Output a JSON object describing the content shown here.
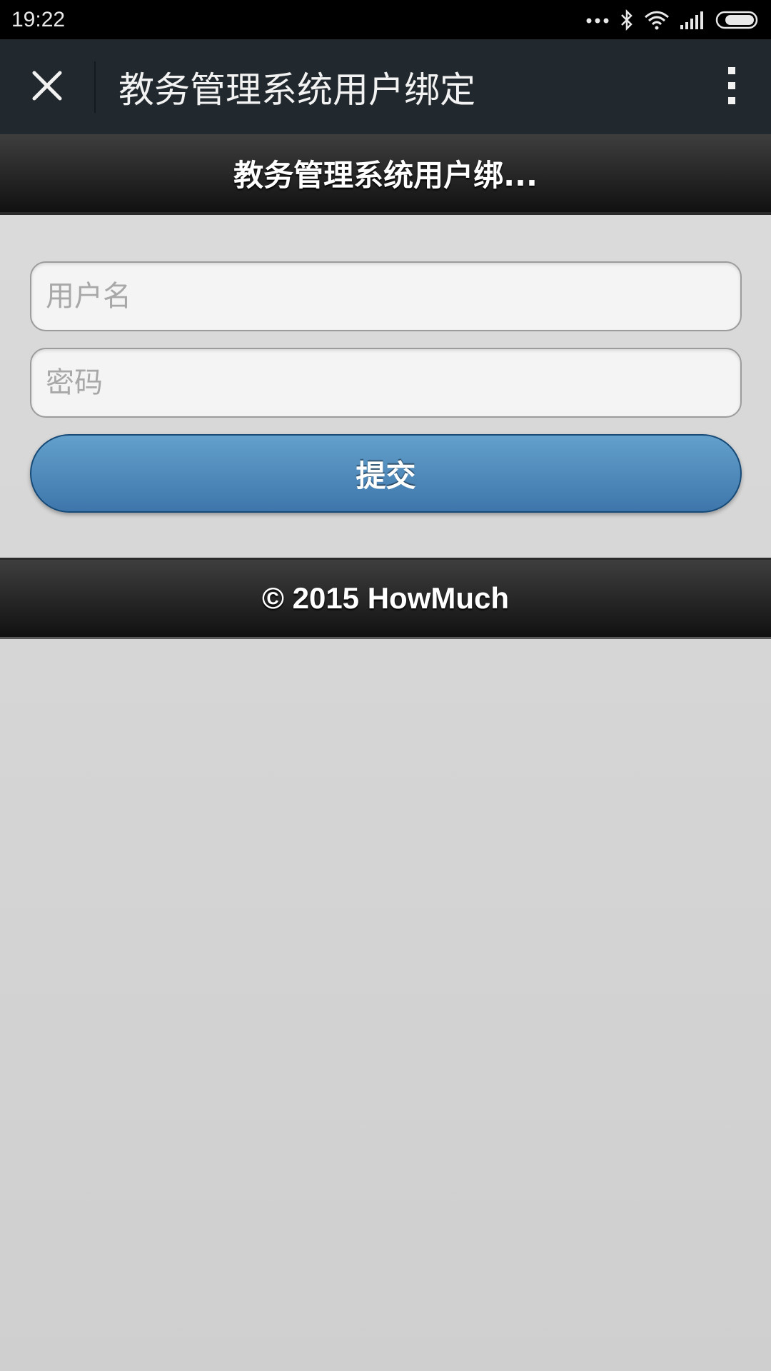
{
  "status_bar": {
    "time": "19:22",
    "icons": [
      "more-dots-icon",
      "bluetooth-icon",
      "wifi-icon",
      "signal-icon",
      "battery-icon"
    ]
  },
  "app_bar": {
    "close_icon": "close-icon",
    "title": "教务管理系统用户绑定",
    "more_icon": "more-vertical-icon",
    "background": "#22292e"
  },
  "page_header": {
    "title": "教务管理系统用户绑..."
  },
  "form": {
    "username": {
      "value": "",
      "placeholder": "用户名"
    },
    "password": {
      "value": "",
      "placeholder": "密码"
    },
    "submit_label": "提交",
    "submit_color": "#4a86b8"
  },
  "footer": {
    "text": "© 2015 HowMuch"
  }
}
